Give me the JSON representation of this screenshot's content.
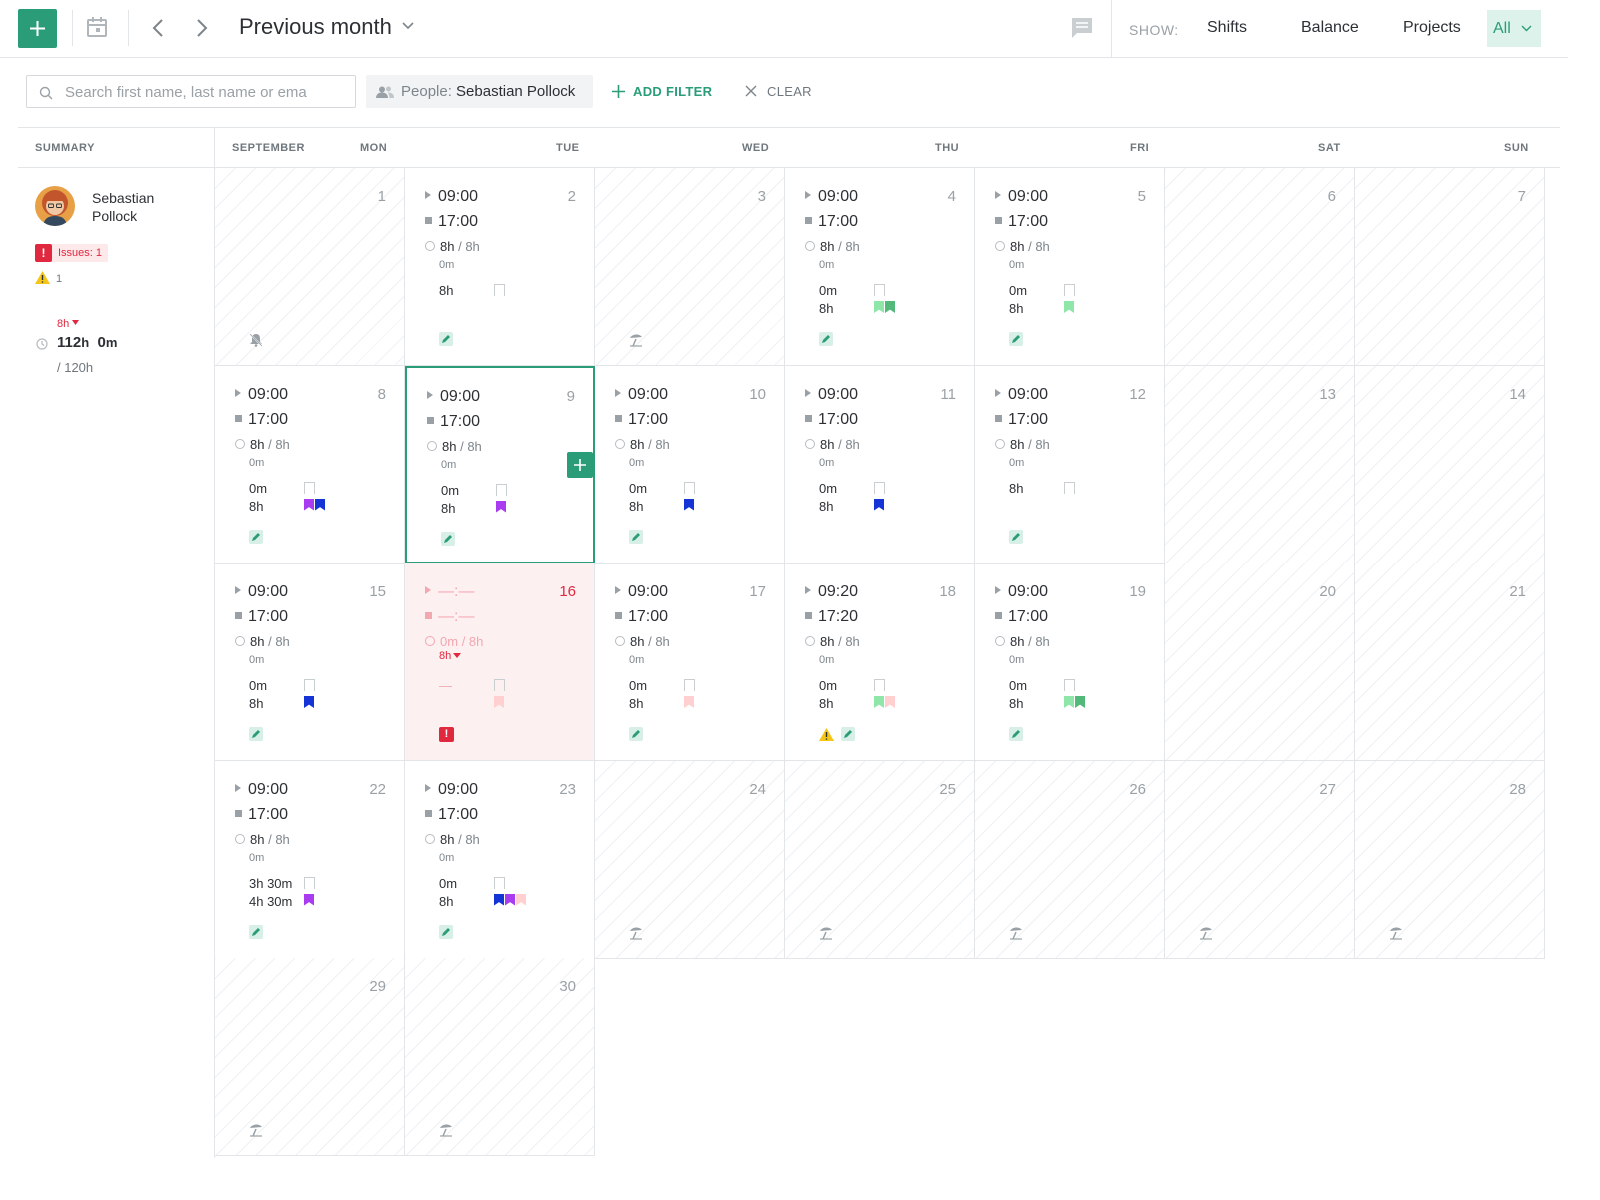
{
  "toolbar": {
    "period_label": "Previous month",
    "show_label": "SHOW:",
    "show_options": [
      "Shifts",
      "Balance",
      "Projects"
    ],
    "show_selected": "All"
  },
  "filters": {
    "search_placeholder": "Search first name, last name or ema",
    "people_label": "People:",
    "people_value": "Sebastian Pollock",
    "add_filter_label": "ADD FILTER",
    "clear_label": "CLEAR"
  },
  "headers": {
    "summary": "SUMMARY",
    "month": "SEPTEMBER",
    "weekdays": [
      "MON",
      "TUE",
      "WED",
      "THU",
      "FRI",
      "SAT",
      "SUN"
    ]
  },
  "summary": {
    "name_first": "Sebastian",
    "name_last": "Pollock",
    "issues_label": "Issues: 1",
    "warnings_count": "1",
    "diff": "8h",
    "total_hours": "112",
    "total_hours_unit": "h",
    "total_minutes": "0",
    "total_minutes_unit": "m",
    "goal": "/ 120h"
  },
  "colors": {
    "accent": "#2a9d78",
    "issue": "#e0283f",
    "warning": "#f5c518",
    "project_purple": "#a93bf0",
    "project_blue": "#1434d6",
    "project_green": "#52b97a",
    "project_lightgreen": "#8ee6a9",
    "project_pink": "#ffd0cf"
  },
  "days": [
    {
      "day": "1",
      "type": "off",
      "icon": "bell-off-icon"
    },
    {
      "day": "2",
      "type": "work",
      "start": "09:00",
      "end": "17:00",
      "hours": "8h",
      "target": "/ 8h",
      "break": "0m",
      "proj_top": "8h",
      "flags": [],
      "flag_outline": true,
      "issue": false,
      "warning": false
    },
    {
      "day": "3",
      "type": "off",
      "icon": "beach-icon"
    },
    {
      "day": "4",
      "type": "work",
      "start": "09:00",
      "end": "17:00",
      "hours": "8h",
      "target": "/ 8h",
      "break": "0m",
      "proj_top": "0m",
      "proj_bottom": "8h",
      "flags": [
        "project_lightgreen",
        "project_green"
      ],
      "flag_outline": true
    },
    {
      "day": "5",
      "type": "work",
      "start": "09:00",
      "end": "17:00",
      "hours": "8h",
      "target": "/ 8h",
      "break": "0m",
      "proj_top": "0m",
      "proj_bottom": "8h",
      "flags": [
        "project_lightgreen"
      ],
      "flag_outline": true
    },
    {
      "day": "6",
      "type": "weekend"
    },
    {
      "day": "7",
      "type": "weekend"
    },
    {
      "day": "8",
      "type": "work",
      "start": "09:00",
      "end": "17:00",
      "hours": "8h",
      "target": "/ 8h",
      "break": "0m",
      "proj_top": "0m",
      "proj_bottom": "8h",
      "flags": [
        "project_purple",
        "project_blue"
      ],
      "flag_outline": true
    },
    {
      "day": "9",
      "type": "work",
      "selected": true,
      "start": "09:00",
      "end": "17:00",
      "hours": "8h",
      "target": "/ 8h",
      "break": "0m",
      "proj_top": "0m",
      "proj_bottom": "8h",
      "flags": [
        "project_purple"
      ],
      "flag_outline": true
    },
    {
      "day": "10",
      "type": "work",
      "start": "09:00",
      "end": "17:00",
      "hours": "8h",
      "target": "/ 8h",
      "break": "0m",
      "proj_top": "0m",
      "proj_bottom": "8h",
      "flags": [
        "project_blue"
      ],
      "flag_outline": true
    },
    {
      "day": "11",
      "type": "work",
      "start": "09:00",
      "end": "17:00",
      "hours": "8h",
      "target": "/ 8h",
      "break": "0m",
      "proj_top": "0m",
      "proj_bottom": "8h",
      "flags": [
        "project_blue"
      ],
      "flag_outline": true,
      "no_edit": true
    },
    {
      "day": "12",
      "type": "work",
      "start": "09:00",
      "end": "17:00",
      "hours": "8h",
      "target": "/ 8h",
      "break": "0m",
      "proj_top": "8h",
      "flags": [],
      "flag_outline": true
    },
    {
      "day": "13",
      "type": "weekend"
    },
    {
      "day": "14",
      "type": "weekend"
    },
    {
      "day": "15",
      "type": "work",
      "start": "09:00",
      "end": "17:00",
      "hours": "8h",
      "target": "/ 8h",
      "break": "0m",
      "proj_top": "0m",
      "proj_bottom": "8h",
      "flags": [
        "project_blue"
      ],
      "flag_outline": true
    },
    {
      "day": "16",
      "type": "issue",
      "start": "—:—",
      "end": "—:—",
      "hours": "0m",
      "target": "/ 8h",
      "diff": "8h",
      "proj_top": "—",
      "flags": [
        "project_pink"
      ],
      "flag_outline": true
    },
    {
      "day": "17",
      "type": "work",
      "start": "09:00",
      "end": "17:00",
      "hours": "8h",
      "target": "/ 8h",
      "break": "0m",
      "proj_top": "0m",
      "proj_bottom": "8h",
      "flags": [
        "project_pink"
      ],
      "flag_outline": true
    },
    {
      "day": "18",
      "type": "work",
      "start": "09:20",
      "end": "17:20",
      "hours": "8h",
      "target": "/ 8h",
      "break": "0m",
      "proj_top": "0m",
      "proj_bottom": "8h",
      "flags": [
        "project_lightgreen",
        "project_pink"
      ],
      "flag_outline": true,
      "warning": true
    },
    {
      "day": "19",
      "type": "work",
      "start": "09:00",
      "end": "17:00",
      "hours": "8h",
      "target": "/ 8h",
      "break": "0m",
      "proj_top": "0m",
      "proj_bottom": "8h",
      "flags": [
        "project_lightgreen",
        "project_green"
      ],
      "flag_outline": true
    },
    {
      "day": "20",
      "type": "weekend"
    },
    {
      "day": "21",
      "type": "weekend"
    },
    {
      "day": "22",
      "type": "work",
      "start": "09:00",
      "end": "17:00",
      "hours": "8h",
      "target": "/ 8h",
      "break": "0m",
      "proj_top": "3h 30m",
      "proj_bottom": "4h 30m",
      "flags": [
        "project_purple"
      ],
      "flag_outline": true
    },
    {
      "day": "23",
      "type": "work",
      "start": "09:00",
      "end": "17:00",
      "hours": "8h",
      "target": "/ 8h",
      "break": "0m",
      "proj_top": "0m",
      "proj_bottom": "8h",
      "flags": [
        "project_blue",
        "project_purple",
        "project_pink"
      ],
      "flag_outline": true
    },
    {
      "day": "24",
      "type": "off",
      "icon": "beach-icon"
    },
    {
      "day": "25",
      "type": "off",
      "icon": "beach-icon"
    },
    {
      "day": "26",
      "type": "off",
      "icon": "beach-icon"
    },
    {
      "day": "27",
      "type": "off",
      "icon": "beach-icon"
    },
    {
      "day": "28",
      "type": "off",
      "icon": "beach-icon"
    },
    {
      "day": "29",
      "type": "off",
      "icon": "beach-icon"
    },
    {
      "day": "30",
      "type": "off",
      "icon": "beach-icon"
    }
  ]
}
